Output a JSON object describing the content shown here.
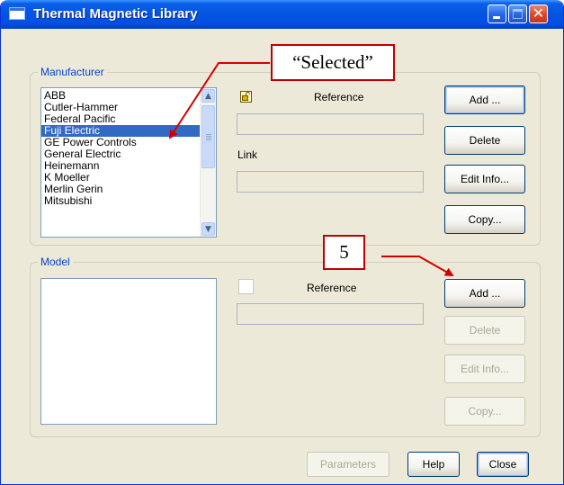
{
  "window": {
    "title": "Thermal Magnetic Library"
  },
  "manufacturer": {
    "group_label": "Manufacturer",
    "items": [
      "ABB",
      "Cutler-Hammer",
      "Federal Pacific",
      "Fuji Electric",
      "GE Power Controls",
      "General Electric",
      "Heinemann",
      "K Moeller",
      "Merlin Gerin",
      "Mitsubishi"
    ],
    "selected": "Fuji Electric",
    "reference_label": "Reference",
    "reference_value": "",
    "link_label": "Link",
    "link_value": "",
    "buttons": {
      "add": "Add ...",
      "delete": "Delete",
      "edit_info": "Edit Info...",
      "copy": "Copy..."
    }
  },
  "model": {
    "group_label": "Model",
    "reference_label": "Reference",
    "reference_value": "",
    "buttons": {
      "add": "Add ...",
      "delete": "Delete",
      "edit_info": "Edit Info...",
      "copy": "Copy..."
    }
  },
  "footer": {
    "parameters": "Parameters",
    "help": "Help",
    "close": "Close"
  },
  "annotations": {
    "selected_callout": "“Selected”",
    "step_callout": "5"
  },
  "colors": {
    "accent": "#c00000",
    "selection": "#316ac5",
    "group_label": "#0046d5",
    "dialog_bg": "#ece9d8"
  },
  "icons": {
    "lock": "lock-icon",
    "scroll_up": "scroll-up-icon",
    "scroll_down": "scroll-down-icon"
  }
}
